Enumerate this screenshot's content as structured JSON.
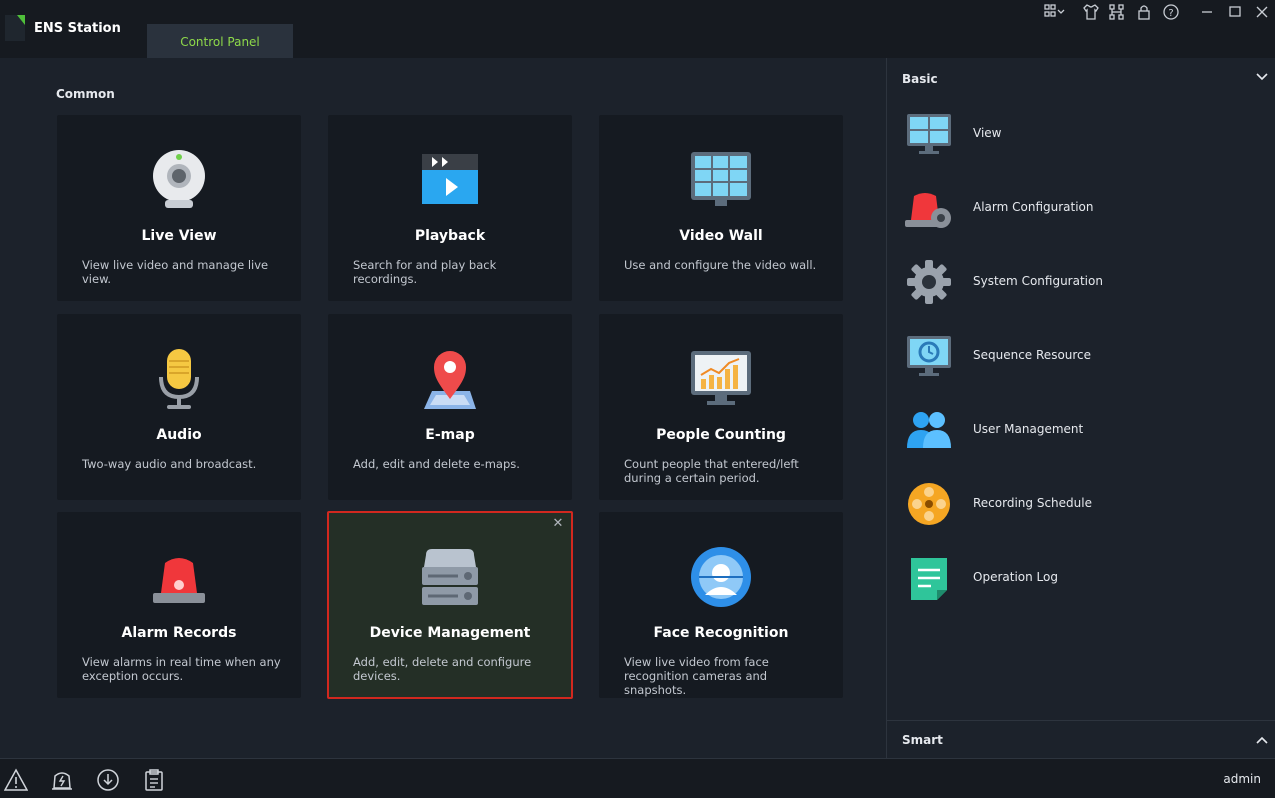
{
  "app": {
    "title": "ENS Station"
  },
  "tabs": [
    {
      "label": "Control Panel"
    }
  ],
  "titlebar_icons": [
    "layout-grid-icon",
    "skin-shirt-icon",
    "network-icon",
    "lock-icon",
    "help-icon",
    "minimize-icon",
    "maximize-icon",
    "close-icon"
  ],
  "main": {
    "section_title": "Common",
    "cards": [
      {
        "title": "Live View",
        "desc": "View live video and manage live view.",
        "icon": "webcam-icon"
      },
      {
        "title": "Playback",
        "desc": "Search for and play back recordings.",
        "icon": "clapperboard-icon"
      },
      {
        "title": "Video Wall",
        "desc": "Use and configure the video wall.",
        "icon": "video-wall-icon"
      },
      {
        "title": "Audio",
        "desc": "Two-way audio and broadcast.",
        "icon": "microphone-icon"
      },
      {
        "title": "E-map",
        "desc": "Add, edit and delete e-maps.",
        "icon": "map-pin-icon"
      },
      {
        "title": "People Counting",
        "desc": "Count people that entered/left during a certain period.",
        "icon": "chart-monitor-icon"
      },
      {
        "title": "Alarm Records",
        "desc": "View alarms in real time when any exception occurs.",
        "icon": "alarm-light-icon"
      },
      {
        "title": "Device Management",
        "desc": "Add, edit, delete and configure devices.",
        "icon": "server-icon",
        "selected": true
      },
      {
        "title": "Face Recognition",
        "desc": "View live video from face recognition cameras and snapshots.",
        "icon": "face-recognition-icon"
      }
    ]
  },
  "right_panel": {
    "basic_label": "Basic",
    "items": [
      {
        "label": "View",
        "icon": "monitor-view-icon"
      },
      {
        "label": "Alarm Configuration",
        "icon": "alarm-config-icon"
      },
      {
        "label": "System Configuration",
        "icon": "gear-icon"
      },
      {
        "label": "Sequence Resource",
        "icon": "sequence-monitor-icon"
      },
      {
        "label": "User Management",
        "icon": "users-icon"
      },
      {
        "label": "Recording Schedule",
        "icon": "film-reel-icon"
      },
      {
        "label": "Operation Log",
        "icon": "log-document-icon"
      }
    ],
    "smart_label": "Smart"
  },
  "bottom": {
    "icons": [
      "warning-icon",
      "alarm-bell-icon",
      "download-icon",
      "clipboard-icon"
    ],
    "user": "admin"
  },
  "colors": {
    "accent_green": "#8ed94a",
    "selection_border": "#d2281f",
    "bg": "#1c222b"
  }
}
